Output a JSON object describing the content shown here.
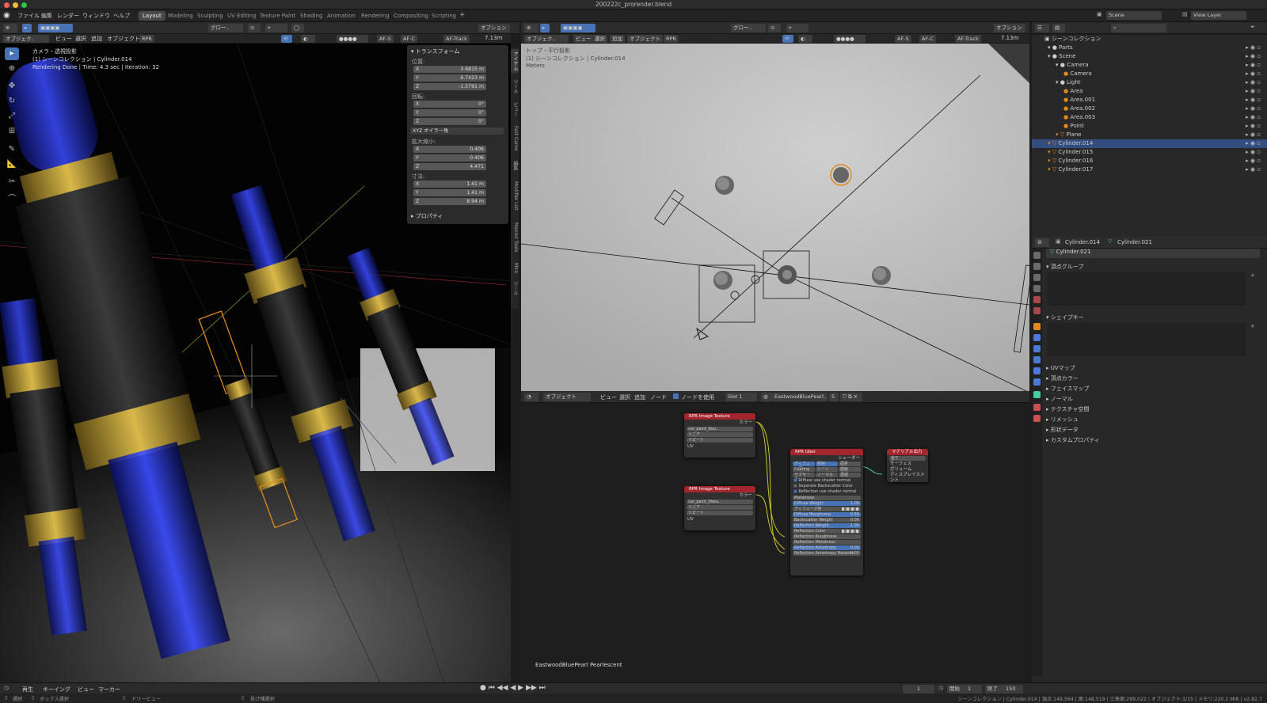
{
  "window": {
    "title": "200222c_prorender.blend"
  },
  "menus": [
    "ファイル",
    "編集",
    "レンダー",
    "ウィンドウ",
    "ヘルプ"
  ],
  "workspaces": [
    {
      "label": "Layout",
      "active": true
    },
    {
      "label": "Modeling"
    },
    {
      "label": "Sculpting"
    },
    {
      "label": "UV Editing"
    },
    {
      "label": "Texture Paint"
    },
    {
      "label": "Shading"
    },
    {
      "label": "Animation"
    },
    {
      "label": "Rendering"
    },
    {
      "label": "Compositing"
    },
    {
      "label": "Scripting"
    }
  ],
  "scene_selector": {
    "label": "Scene",
    "view_layer": "View Layer"
  },
  "viewport1": {
    "header": {
      "mode": "オブジェク..",
      "menus": [
        "ビュー",
        "選択",
        "追加",
        "オブジェクト",
        "RPR"
      ],
      "orientation": "グロー..",
      "afs": "AF-S",
      "afc": "AF-C",
      "aftrack": "AF-Track",
      "distance": "7.13m",
      "options": "オプション"
    },
    "overlay": [
      "カメラ・透視投影",
      "(1) シーンコレクション | Cylinder.014",
      "Rendering Done | Time: 4.3 sec | Iteration: 32"
    ],
    "npanel": {
      "transform": "トランスフォーム",
      "location": "位置:",
      "loc": [
        {
          "k": "X",
          "v": "3.6815 m"
        },
        {
          "k": "Y",
          "v": "6.7423 m"
        },
        {
          "k": "Z",
          "v": "-1.5791 m"
        }
      ],
      "rotation": "回転:",
      "rot": [
        {
          "k": "X",
          "v": "0°"
        },
        {
          "k": "Y",
          "v": "0°"
        },
        {
          "k": "Z",
          "v": "0°"
        }
      ],
      "euler": "XYZ オイラー角",
      "scale": "拡大縮小:",
      "scl": [
        {
          "k": "X",
          "v": "0.406"
        },
        {
          "k": "Y",
          "v": "0.406"
        },
        {
          "k": "Z",
          "v": "4.471"
        }
      ],
      "dims": "寸法:",
      "dim": [
        {
          "k": "X",
          "v": "1.41 m"
        },
        {
          "k": "Y",
          "v": "1.41 m"
        },
        {
          "k": "Z",
          "v": "8.94 m"
        }
      ],
      "properties": "プロパティ"
    },
    "tabs": [
      "アイテム",
      "ツール",
      "ビュー",
      "Fast Carve",
      "編集",
      "Modifier List",
      "Maxivz Tools",
      "Mira",
      "ツール"
    ]
  },
  "viewport2": {
    "header": {
      "mode": "オブジェク..",
      "menus": [
        "ビュー",
        "選択",
        "追加",
        "オブジェクト",
        "RPR"
      ],
      "orientation": "グロー..",
      "afs": "AF-S",
      "afc": "AF-C",
      "aftrack": "AF-Track",
      "distance": "7.13m",
      "options": "オプション"
    },
    "overlay": [
      "トップ・平行投影",
      "(1) シーンコレクション | Cylinder.014",
      "Meters"
    ]
  },
  "node_editor": {
    "header": {
      "type": "オブジェクト",
      "menus": [
        "ビュー",
        "選択",
        "追加",
        "ノード"
      ],
      "use_nodes": "ノードを使用",
      "slot": "Slot 1",
      "material": "EastwoodBluePearl..",
      "users": "5"
    },
    "material_label": "EastwoodBluePearl Pearlescent",
    "tex1": {
      "title": "RPR Image Texture",
      "color": "カラー",
      "file": "car_paint_Rou..",
      "interp": "リニア",
      "ext": "リピート",
      "uv": "UV"
    },
    "tex2": {
      "title": "RPR Image Texture",
      "color": "カラー",
      "file": "car_paint_Meta..",
      "interp": "リニア",
      "ext": "リピート",
      "uv": "UV"
    },
    "uber": {
      "title": "RPR Uber",
      "out": "シェーダー",
      "tabs1": [
        "ディフューズ",
        "反射",
        "屈折"
      ],
      "tabs2": [
        "Coating",
        "シーン",
        "放射"
      ],
      "tabs3": [
        "サブサーフ..",
        "ノーマル",
        "透過"
      ],
      "checks": [
        "Diffuse use shader normal",
        "Separate Backscatter Color",
        "Reflection use shader normal"
      ],
      "metalness": "Metalness",
      "rows": [
        {
          "k": "Diffuse Weight",
          "v": "1.00",
          "blue": true
        },
        {
          "k": "ディフューズ色",
          "v": "",
          "swatch": true
        },
        {
          "k": "Diffuse Roughness",
          "v": "0.50",
          "blue": true
        },
        {
          "k": "Backscatter Weight",
          "v": "0.00"
        },
        {
          "k": "Reflection Weight",
          "v": "1.00",
          "blue": true
        },
        {
          "k": "Reflection Color",
          "v": "",
          "swatch": true
        },
        {
          "k": "Reflection Roughness",
          "v": ""
        },
        {
          "k": "Reflection Metalness",
          "v": ""
        },
        {
          "k": "Reflection Anisotropy",
          "v": "0.00",
          "blue": true
        },
        {
          "k": "Reflection Anisotropy Rotation",
          "v": "0.00"
        }
      ]
    },
    "output": {
      "title": "マテリアル出力",
      "target": "全て",
      "sockets": [
        "サーフェス",
        "ボリューム",
        "ディスプレイスメント"
      ]
    }
  },
  "outliner": {
    "root": "シーンコレクション",
    "items": [
      {
        "label": "Parts",
        "depth": 1
      },
      {
        "label": "Scene",
        "depth": 1
      },
      {
        "label": "Camera",
        "depth": 2
      },
      {
        "label": "Camera",
        "depth": 3
      },
      {
        "label": "Light",
        "depth": 2
      },
      {
        "label": "Area",
        "depth": 3
      },
      {
        "label": "Area.001",
        "depth": 3
      },
      {
        "label": "Area.002",
        "depth": 3
      },
      {
        "label": "Area.003",
        "depth": 3
      },
      {
        "label": "Point",
        "depth": 3
      },
      {
        "label": "Plane",
        "depth": 2
      },
      {
        "label": "Cylinder.014",
        "depth": 1,
        "selected": true
      },
      {
        "label": "Cylinder.015",
        "depth": 1
      },
      {
        "label": "Cylinder.016",
        "depth": 1
      },
      {
        "label": "Cylinder.017",
        "depth": 1
      }
    ]
  },
  "properties": {
    "object": "Cylinder.014",
    "mesh": "Cylinder.021",
    "datablock": "Cylinder.021",
    "vertex_groups": "頂点グループ",
    "shape_keys": "シェイプキー",
    "sections": [
      "UVマップ",
      "頂点カラー",
      "フェイスマップ",
      "ノーマル",
      "テクスチャ空間",
      "リメッシュ",
      "形状データ",
      "カスタムプロパティ"
    ]
  },
  "timeline": {
    "menus": [
      "再生",
      "キーイング",
      "ビュー",
      "マーカー"
    ],
    "frame": "1",
    "start_label": "開始",
    "start": "1",
    "end_label": "終了",
    "end": "150"
  },
  "status": {
    "left": [
      "選択",
      "ボックス選択",
      "ドリービュー",
      "投げ縄選択"
    ],
    "right": "シーンコレクション | Cylinder.014 | 頂点:149,564 | 面:148,519 | 三角面:299,022 | オブジェクト:1/15 | メモリ:220.1 MiB | v2.82.7"
  },
  "colors": {
    "accent": "#4772b3",
    "selection_orange": "#e08a20",
    "node_red": "#a3252e",
    "gold": "#b8972e",
    "blue_glass": "#1f2bd1"
  }
}
